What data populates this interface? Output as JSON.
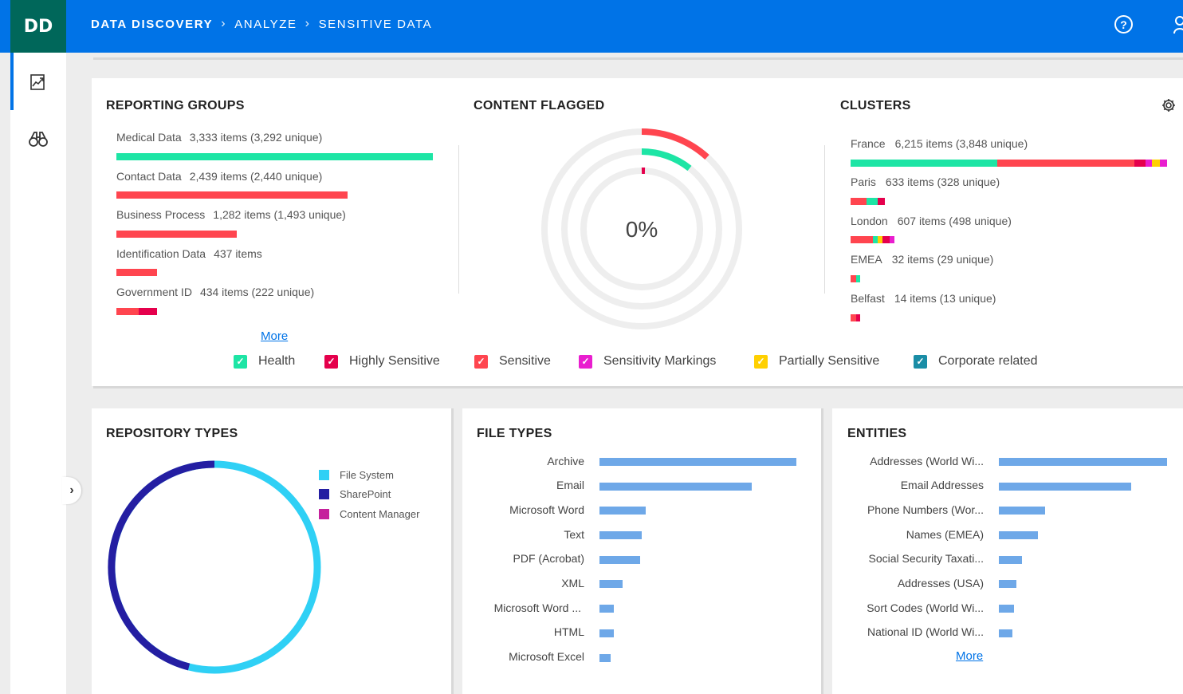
{
  "app": {
    "logo": "DD"
  },
  "breadcrumb": [
    "DATA DISCOVERY",
    "ANALYZE",
    "SENSITIVE DATA"
  ],
  "header": {
    "help_icon": "?"
  },
  "rail": {
    "icons": [
      "trend-report-icon",
      "binoculars-icon"
    ],
    "expand_glyph": "›"
  },
  "reporting_groups": {
    "title": "REPORTING GROUPS",
    "items": [
      {
        "name": "Medical Data",
        "detail": "3,333 items (3,292 unique)"
      },
      {
        "name": "Contact Data",
        "detail": "2,439 items (2,440 unique)"
      },
      {
        "name": "Business Process",
        "detail": "1,282 items (1,493 unique)"
      },
      {
        "name": "Identification Data",
        "detail": "437 items"
      },
      {
        "name": "Government ID",
        "detail": "434 items (222 unique)"
      }
    ],
    "more": "More"
  },
  "content_flagged": {
    "title": "CONTENT FLAGGED",
    "value": "0%"
  },
  "clusters": {
    "title": "CLUSTERS",
    "items": [
      {
        "name": "France",
        "detail": "6,215 items (3,848 unique)"
      },
      {
        "name": "Paris",
        "detail": "633 items (328 unique)"
      },
      {
        "name": "London",
        "detail": "607 items (498 unique)"
      },
      {
        "name": "EMEA",
        "detail": "32 items (29 unique)"
      },
      {
        "name": "Belfast",
        "detail": "14 items (13 unique)"
      }
    ]
  },
  "legend": [
    {
      "label": "Health",
      "color": "#1de5a5"
    },
    {
      "label": "Highly Sensitive",
      "color": "#e5004c"
    },
    {
      "label": "Sensitive",
      "color": "#ff454f"
    },
    {
      "label": "Sensitivity Markings",
      "color": "#e91ecf"
    },
    {
      "label": "Partially Sensitive",
      "color": "#ffd000"
    },
    {
      "label": "Corporate related",
      "color": "#1a8da6"
    }
  ],
  "repository_types": {
    "title": "REPOSITORY TYPES",
    "legend": [
      {
        "label": "File System",
        "color": "#2fd0f5"
      },
      {
        "label": "SharePoint",
        "color": "#241ea2"
      },
      {
        "label": "Content Manager",
        "color": "#c5219c"
      }
    ]
  },
  "file_types": {
    "title": "FILE TYPES",
    "items": [
      "Archive",
      "Email",
      "Microsoft Word",
      "Text",
      "PDF (Acrobat)",
      "XML",
      "Microsoft Word ...",
      "HTML",
      "Microsoft Excel"
    ]
  },
  "entities": {
    "title": "ENTITIES",
    "items": [
      "Addresses (World Wi...",
      "Email Addresses",
      "Phone Numbers (Wor...",
      "Names (EMEA)",
      "Social Security Taxati...",
      "Addresses (USA)",
      "Sort Codes (World Wi...",
      "National ID (World Wi..."
    ],
    "more": "More"
  }
}
